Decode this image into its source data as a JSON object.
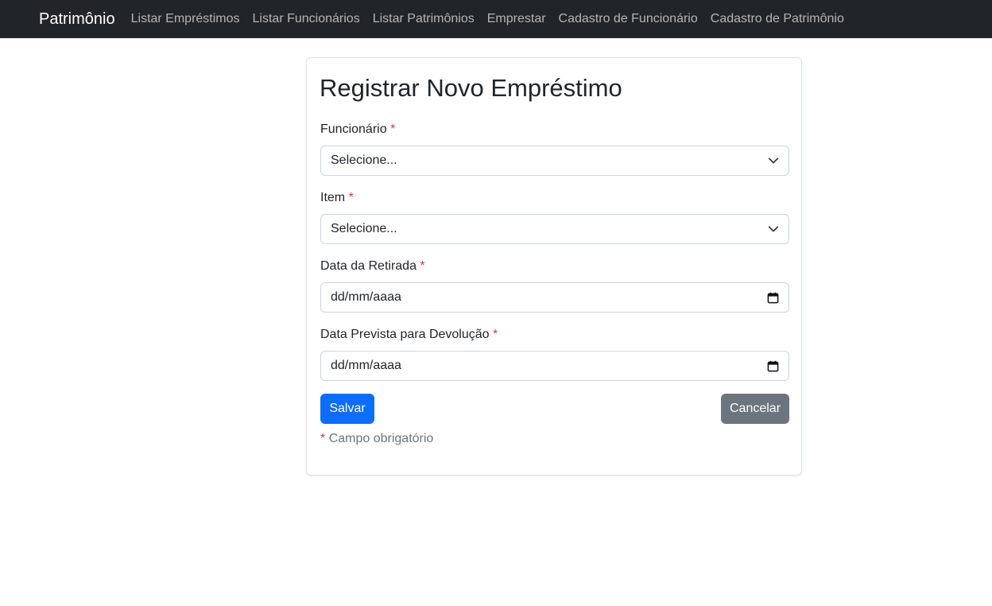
{
  "navbar": {
    "brand": "Patrimônio",
    "links": [
      {
        "label": "Listar Empréstimos"
      },
      {
        "label": "Listar Funcionários"
      },
      {
        "label": "Listar Patrimônios"
      },
      {
        "label": "Emprestar"
      },
      {
        "label": "Cadastro de Funcionário"
      },
      {
        "label": "Cadastro de Patrimônio"
      }
    ]
  },
  "form": {
    "title": "Registrar Novo Empréstimo",
    "required_mark": "*",
    "fields": {
      "funcionario": {
        "label": "Funcionário",
        "value": "Selecione..."
      },
      "item": {
        "label": "Item",
        "value": "Selecione..."
      },
      "data_retirada": {
        "label": "Data da Retirada",
        "value": "dd/mm/aaaa"
      },
      "data_devolucao": {
        "label": "Data Prevista para Devolução",
        "value": "dd/mm/aaaa"
      }
    },
    "buttons": {
      "save": "Salvar",
      "cancel": "Cancelar"
    },
    "footnote": "Campo obrigatório"
  },
  "colors": {
    "navbar_bg": "#212529",
    "primary": "#0d6efd",
    "secondary": "#6c757d",
    "required": "#dc3545"
  }
}
